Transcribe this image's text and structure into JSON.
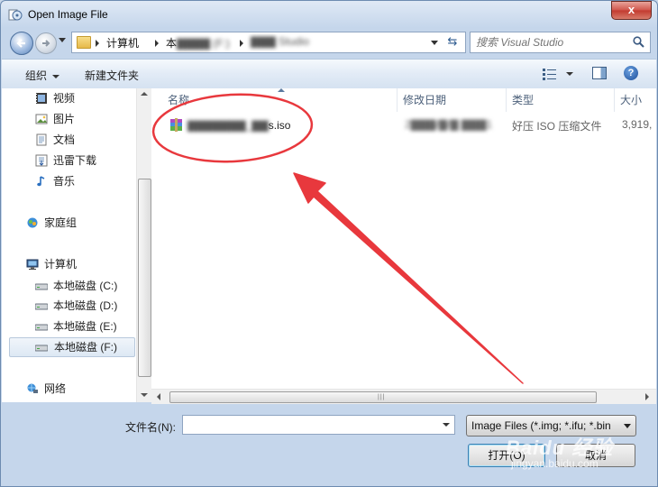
{
  "window": {
    "title": "Open Image File",
    "close_label": "x"
  },
  "nav": {
    "address_segments": [
      "计算机",
      "本",
      "▇▇▇▇ (F:)",
      "▇▇▇ Studio"
    ],
    "search_placeholder": "搜索 Visual Studio"
  },
  "toolbar": {
    "organize": "组织",
    "new_folder": "新建文件夹"
  },
  "sidebar": {
    "libraries": [
      {
        "label": "视频",
        "icon": "video-icon"
      },
      {
        "label": "图片",
        "icon": "picture-icon"
      },
      {
        "label": "文档",
        "icon": "document-icon"
      },
      {
        "label": "迅雷下载",
        "icon": "download-icon"
      },
      {
        "label": "音乐",
        "icon": "music-icon"
      }
    ],
    "homegroup": "家庭组",
    "computer": "计算机",
    "drives": [
      {
        "label": "本地磁盘 (C:)"
      },
      {
        "label": "本地磁盘 (D:)"
      },
      {
        "label": "本地磁盘 (E:)"
      },
      {
        "label": "本地磁盘 (F:)",
        "selected": true
      }
    ],
    "network": "网络"
  },
  "columns": {
    "name": "名称",
    "modified": "修改日期",
    "type": "类型",
    "size": "大小"
  },
  "files": [
    {
      "name_blurred": "▇▇▇▇▇▇▇_▇▇",
      "name_suffix": "s.iso",
      "modified": "2▇▇▇/▇/▇ ▇▇▇1",
      "type": "好压 ISO 压缩文件",
      "size": "3,919,"
    }
  ],
  "footer": {
    "filename_label": "文件名(N):",
    "filename_value": "",
    "filter": "Image Files (*.img; *.ifu; *.bin",
    "open_button": "打开(O)",
    "cancel_button": "取消"
  },
  "watermark": {
    "brand": "Baidu 经验",
    "url": "jingyan.baidu.com"
  },
  "colors": {
    "annotation": "#e8383d",
    "selection": "#dde8f4"
  }
}
